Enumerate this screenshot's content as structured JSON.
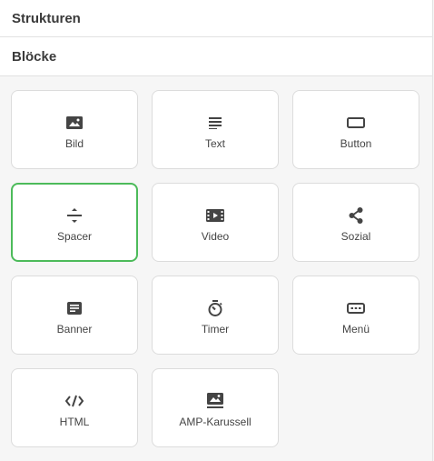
{
  "sections": {
    "structures_label": "Strukturen",
    "blocks_label": "Blöcke"
  },
  "blocks": [
    {
      "label": "Bild",
      "icon": "image-icon"
    },
    {
      "label": "Text",
      "icon": "text-lines-icon"
    },
    {
      "label": "Button",
      "icon": "button-rectangle-icon"
    },
    {
      "label": "Spacer",
      "icon": "spacer-divide-icon",
      "selected": true
    },
    {
      "label": "Video",
      "icon": "video-icon"
    },
    {
      "label": "Sozial",
      "icon": "share-icon"
    },
    {
      "label": "Banner",
      "icon": "banner-icon"
    },
    {
      "label": "Timer",
      "icon": "timer-icon"
    },
    {
      "label": "Menü",
      "icon": "menu-icon"
    },
    {
      "label": "HTML",
      "icon": "code-icon"
    },
    {
      "label": "AMP-Karussell",
      "icon": "carousel-image-icon"
    }
  ],
  "colors": {
    "selected_border": "#4cbb5a",
    "tile_border": "#dcdcdc",
    "icon": "#444444"
  }
}
